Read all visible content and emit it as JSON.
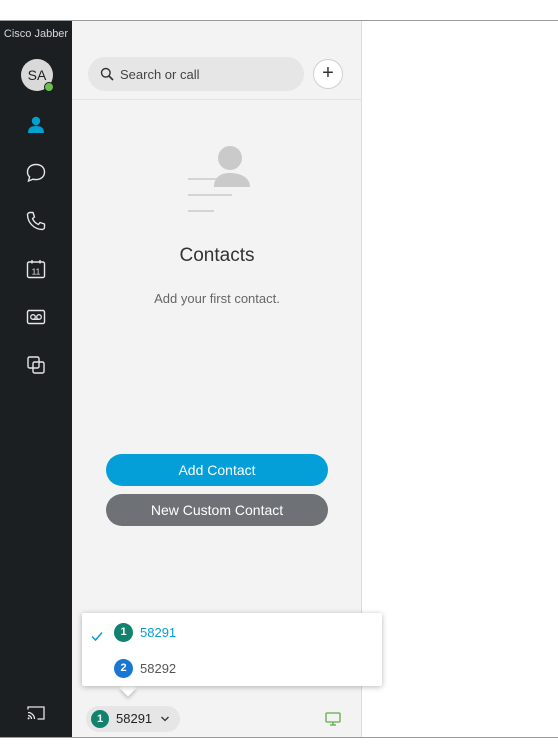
{
  "app": {
    "title": "Cisco Jabber"
  },
  "user": {
    "initials": "SA",
    "presence_color": "#6cc04a"
  },
  "nav": {
    "items": [
      {
        "name": "contacts",
        "icon": "person-icon",
        "active": true
      },
      {
        "name": "chats",
        "icon": "chat-bubble-icon"
      },
      {
        "name": "calls",
        "icon": "phone-icon"
      },
      {
        "name": "meetings",
        "icon": "calendar-icon",
        "badge": "11"
      },
      {
        "name": "voicemail",
        "icon": "voicemail-icon"
      },
      {
        "name": "custom-tabs",
        "icon": "overlap-squares-icon"
      }
    ],
    "bottom_icon": "cast-icon"
  },
  "search": {
    "placeholder": "Search or call"
  },
  "add_button": {
    "symbol": "+"
  },
  "empty_state": {
    "title": "Contacts",
    "subtitle": "Add your first contact.",
    "add_contact_label": "Add Contact",
    "new_custom_label": "New Custom Contact"
  },
  "line_menu": {
    "items": [
      {
        "index": "1",
        "number": "58291",
        "selected": true,
        "badge_color": "#12826f"
      },
      {
        "index": "2",
        "number": "58292",
        "selected": false,
        "badge_color": "#1976d2"
      }
    ]
  },
  "line_selector": {
    "index": "1",
    "number": "58291"
  },
  "colors": {
    "accent": "#049fd9",
    "nav_bg": "#1b1f21",
    "secondary_button": "#6e7175",
    "online": "#6cc04a"
  }
}
